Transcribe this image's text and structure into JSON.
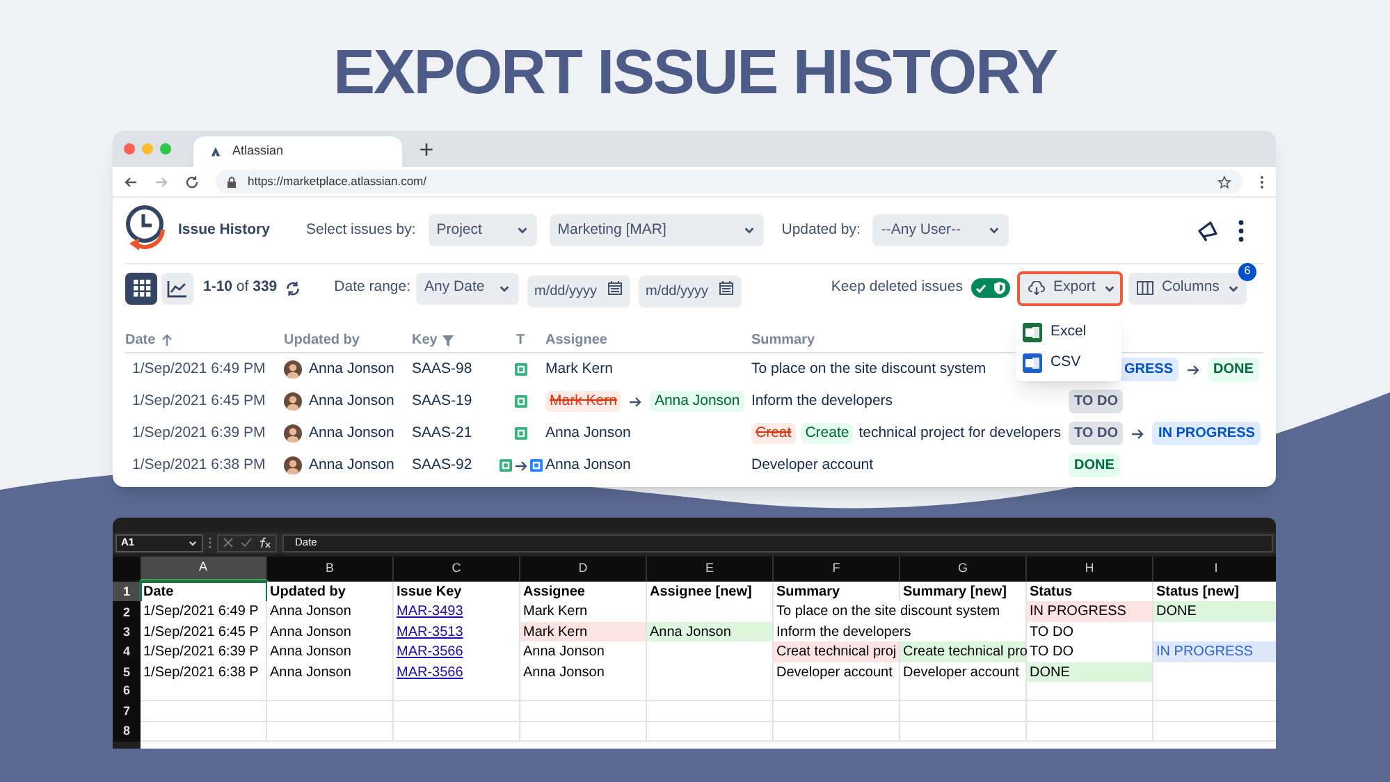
{
  "headline": "EXPORT ISSUE HISTORY",
  "browser": {
    "tab_title": "Atlassian",
    "url": "https://marketplace.atlassian.com/"
  },
  "app": {
    "title": "Issue History",
    "select_label": "Select issues by:",
    "selects": [
      {
        "value": "Project"
      },
      {
        "value": "Marketing [MAR]"
      }
    ],
    "updated_label": "Updated by:",
    "user_select": "--Any User--",
    "views": [
      {
        "kind": "grid",
        "selected": true
      },
      {
        "kind": "chart",
        "selected": false
      }
    ],
    "count": "**1-10** of **339**",
    "date_range_label": "Date range:",
    "date_select": "Any Date",
    "date_fields": [
      {
        "placeholder": "m/dd/yyyy"
      },
      {
        "placeholder": "m/dd/yyyy"
      }
    ],
    "keep_deleted": {
      "label": "Keep deleted issues",
      "on": true
    },
    "export_button": {
      "label": "Export",
      "highlighted": true
    },
    "export_menu": [
      {
        "kind": "excel",
        "label": "Excel"
      },
      {
        "kind": "csv",
        "label": "CSV"
      }
    ],
    "columns_button": {
      "label": "Columns",
      "badge": "6"
    },
    "table": {
      "columns": [
        {
          "label": "Date"
        },
        {
          "label": "Updated by"
        },
        {
          "label": "Key"
        },
        {
          "label": "T"
        },
        {
          "label": "Assignee"
        },
        {
          "label": "Summary"
        }
      ],
      "rows": [
        {
          "date": "1/Sep/2021 6:49 PM",
          "updated_by": "Anna Jonson",
          "key": "SAAS-98",
          "type": [
            {
              "kind": "story"
            }
          ],
          "assignee": [
            {
              "text": "Mark Kern",
              "kind": "plain"
            }
          ],
          "summary": [
            {
              "text": "To place on the site discount system",
              "kind": "plain"
            }
          ],
          "status": [
            {
              "text": "GRESS",
              "kind": "inprogress"
            },
            {
              "text": "DONE",
              "kind": "done"
            }
          ]
        },
        {
          "date": "1/Sep/2021 6:45 PM",
          "updated_by": "Anna Jonson",
          "key": "SAAS-19",
          "type": [
            {
              "kind": "story"
            }
          ],
          "assignee": [
            {
              "text": "Mark Kern",
              "kind": "removed"
            },
            {
              "text": "Anna Jonson",
              "kind": "added"
            }
          ],
          "summary": [
            {
              "text": "Inform the developers",
              "kind": "plain"
            }
          ],
          "status": [
            {
              "text": "TO DO",
              "kind": "todo"
            }
          ]
        },
        {
          "date": "1/Sep/2021 6:39 PM",
          "updated_by": "Anna Jonson",
          "key": "SAAS-21",
          "type": [
            {
              "kind": "story"
            }
          ],
          "assignee": [
            {
              "text": "Anna Jonson",
              "kind": "plain"
            }
          ],
          "summary": [
            {
              "text": "Creat",
              "kind": "removed"
            },
            {
              "text": "Create",
              "kind": "added"
            },
            {
              "text": "technical project for developers",
              "kind": "plain"
            }
          ],
          "status": [
            {
              "text": "TO DO",
              "kind": "todo"
            },
            {
              "text": "IN PROGRESS",
              "kind": "inprogress"
            }
          ]
        },
        {
          "date": "1/Sep/2021 6:38 PM",
          "updated_by": "Anna Jonson",
          "key": "SAAS-92",
          "type": [
            {
              "kind": "story"
            },
            {
              "kind": "task"
            }
          ],
          "assignee": [
            {
              "text": "Anna Jonson",
              "kind": "plain"
            }
          ],
          "summary": [
            {
              "text": "Developer account",
              "kind": "plain"
            }
          ],
          "status": [
            {
              "text": "DONE",
              "kind": "done"
            }
          ]
        }
      ]
    }
  },
  "spreadsheet": {
    "name_box": "A1",
    "formula": "Date",
    "columns": [
      {
        "label": "A",
        "selected": true
      },
      {
        "label": "B",
        "selected": false
      },
      {
        "label": "C",
        "selected": false
      },
      {
        "label": "D",
        "selected": false
      },
      {
        "label": "E",
        "selected": false
      },
      {
        "label": "F",
        "selected": false
      },
      {
        "label": "G",
        "selected": false
      },
      {
        "label": "H",
        "selected": false
      },
      {
        "label": "I",
        "selected": false
      }
    ],
    "rows": [
      {
        "number": "1",
        "selected": true,
        "cells": [
          {
            "text": "Date",
            "kind": "header"
          },
          {
            "text": "Updated by",
            "kind": "header"
          },
          {
            "text": "Issue Key",
            "kind": "header"
          },
          {
            "text": "Assignee",
            "kind": "header"
          },
          {
            "text": "Assignee [new]",
            "kind": "header"
          },
          {
            "text": "Summary",
            "kind": "header"
          },
          {
            "text": "Summary [new]",
            "kind": "header"
          },
          {
            "text": "Status",
            "kind": "header"
          },
          {
            "text": "Status [new]",
            "kind": "header"
          }
        ]
      },
      {
        "number": "2",
        "selected": false,
        "cells": [
          {
            "text": "1/Sep/2021 6:49 P",
            "kind": "text"
          },
          {
            "text": "Anna Jonson",
            "kind": "text"
          },
          {
            "text": "MAR-3493",
            "kind": "link"
          },
          {
            "text": "Mark Kern",
            "kind": "text"
          },
          null,
          {
            "text": "To place on the site discount system",
            "kind": "text"
          },
          null,
          {
            "text": "IN PROGRESS",
            "kind": "removed"
          },
          {
            "text": "DONE",
            "kind": "added"
          }
        ]
      },
      {
        "number": "3",
        "selected": false,
        "cells": [
          {
            "text": "1/Sep/2021 6:45 P",
            "kind": "text"
          },
          {
            "text": "Anna Jonson",
            "kind": "text"
          },
          {
            "text": "MAR-3513",
            "kind": "link"
          },
          {
            "text": "Mark Kern",
            "kind": "removed"
          },
          {
            "text": "Anna Jonson",
            "kind": "added"
          },
          {
            "text": "Inform the developers",
            "kind": "text"
          },
          null,
          {
            "text": "TO DO",
            "kind": "text"
          },
          null
        ]
      },
      {
        "number": "4",
        "selected": false,
        "cells": [
          {
            "text": "1/Sep/2021 6:39 P",
            "kind": "text"
          },
          {
            "text": "Anna Jonson",
            "kind": "text"
          },
          {
            "text": "MAR-3566",
            "kind": "link"
          },
          {
            "text": "Anna Jonson",
            "kind": "text"
          },
          null,
          {
            "text": "Creat technical proj",
            "kind": "removed"
          },
          {
            "text": "Create technical pro",
            "kind": "added"
          },
          {
            "text": "TO DO",
            "kind": "text"
          },
          {
            "text": "IN PROGRESS",
            "kind": "added-blue"
          }
        ]
      },
      {
        "number": "5",
        "selected": false,
        "cells": [
          {
            "text": "1/Sep/2021 6:38 P",
            "kind": "text"
          },
          {
            "text": "Anna Jonson",
            "kind": "text"
          },
          {
            "text": "MAR-3566",
            "kind": "link"
          },
          {
            "text": "Anna Jonson",
            "kind": "text"
          },
          null,
          {
            "text": "Developer account",
            "kind": "text"
          },
          {
            "text": "Developer account",
            "kind": "text"
          },
          {
            "text": "DONE",
            "kind": "added"
          },
          null
        ]
      },
      {
        "number": "6",
        "selected": false
      },
      {
        "number": "7",
        "selected": false
      },
      {
        "number": "8",
        "selected": false
      }
    ]
  }
}
